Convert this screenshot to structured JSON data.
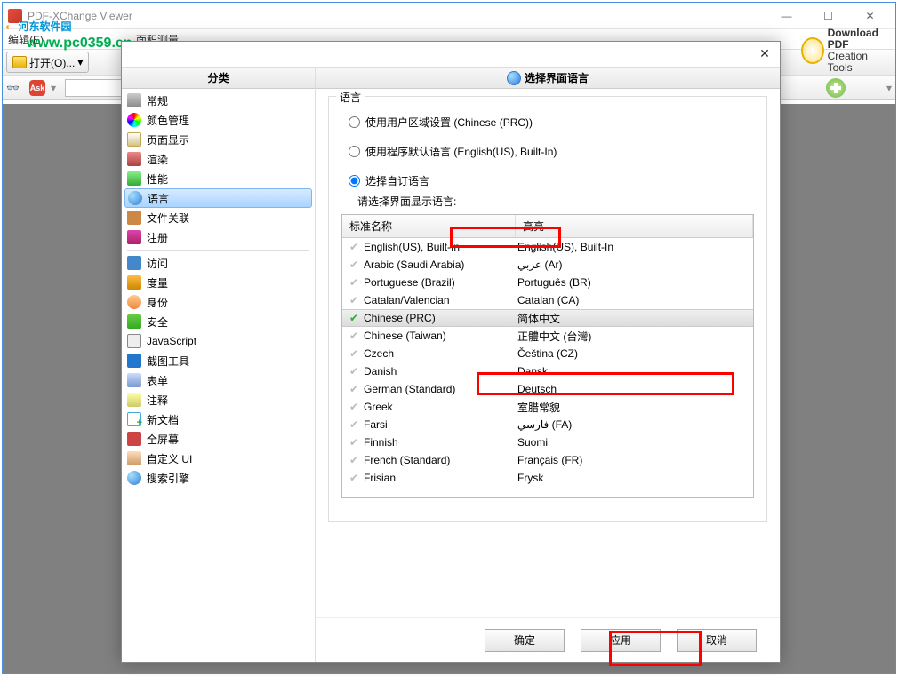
{
  "watermark": {
    "text_cn": "河东软件园",
    "url": "www.pc0359.cn"
  },
  "app": {
    "title": "PDF-XChange Viewer"
  },
  "menubar": {
    "edit": "编辑(E)",
    "area_measure": "面积测量"
  },
  "toolbar": {
    "open": "打开(O)...",
    "ask": "Ask",
    "download_pdf": "Download PDF",
    "creation_tools": "Creation Tools"
  },
  "dialog": {
    "sidebar_header": "分类",
    "content_header": "选择界面语言",
    "sidebar": [
      {
        "label": "常规",
        "icon": "ic-gear"
      },
      {
        "label": "颜色管理",
        "icon": "ic-color"
      },
      {
        "label": "页面显示",
        "icon": "ic-page"
      },
      {
        "label": "渲染",
        "icon": "ic-render"
      },
      {
        "label": "性能",
        "icon": "ic-perf"
      },
      {
        "label": "语言",
        "icon": "ic-lang",
        "selected": true
      },
      {
        "label": "文件关联",
        "icon": "ic-assoc"
      },
      {
        "label": "注册",
        "icon": "ic-reg"
      },
      {
        "sep": true
      },
      {
        "label": "访问",
        "icon": "ic-visit"
      },
      {
        "label": "度量",
        "icon": "ic-meas"
      },
      {
        "label": "身份",
        "icon": "ic-id"
      },
      {
        "label": "安全",
        "icon": "ic-sec"
      },
      {
        "label": "JavaScript",
        "icon": "ic-js"
      },
      {
        "label": "截图工具",
        "icon": "ic-snap"
      },
      {
        "label": "表单",
        "icon": "ic-form"
      },
      {
        "label": "注释",
        "icon": "ic-comm"
      },
      {
        "label": "新文档",
        "icon": "ic-new"
      },
      {
        "label": "全屏幕",
        "icon": "ic-full"
      },
      {
        "label": "自定义 UI",
        "icon": "ic-cust"
      },
      {
        "label": "搜索引擎",
        "icon": "ic-srch"
      }
    ],
    "lang_group_legend": "语言",
    "radio1": "使用用户区域设置 (Chinese (PRC))",
    "radio2": "使用程序默认语言 (English(US), Built-In)",
    "radio3": "选择自订语言",
    "sub_label": "请选择界面显示语言:",
    "table_headers": {
      "name": "标准名称",
      "highlight": "高亮"
    },
    "languages": [
      {
        "name": "English(US), Built-In",
        "native": "English(US), Built-In"
      },
      {
        "name": "Arabic (Saudi Arabia)",
        "native": "عربي (Ar)"
      },
      {
        "name": "Portuguese (Brazil)",
        "native": "Português (BR)"
      },
      {
        "name": "Catalan/Valencian",
        "native": "Catalan (CA)"
      },
      {
        "name": "Chinese (PRC)",
        "native": "简体中文",
        "selected": true
      },
      {
        "name": "Chinese (Taiwan)",
        "native": "正體中文 (台灣)"
      },
      {
        "name": "Czech",
        "native": "Čeština (CZ)"
      },
      {
        "name": "Danish",
        "native": "Dansk"
      },
      {
        "name": "German (Standard)",
        "native": "Deutsch"
      },
      {
        "name": "Greek",
        "native": "室腊常貌"
      },
      {
        "name": "Farsi",
        "native": "فارسي (FA)"
      },
      {
        "name": "Finnish",
        "native": "Suomi"
      },
      {
        "name": "French (Standard)",
        "native": "Français (FR)"
      },
      {
        "name": "Frisian",
        "native": "Frysk"
      }
    ],
    "buttons": {
      "ok": "确定",
      "apply": "应用",
      "cancel": "取消"
    }
  }
}
